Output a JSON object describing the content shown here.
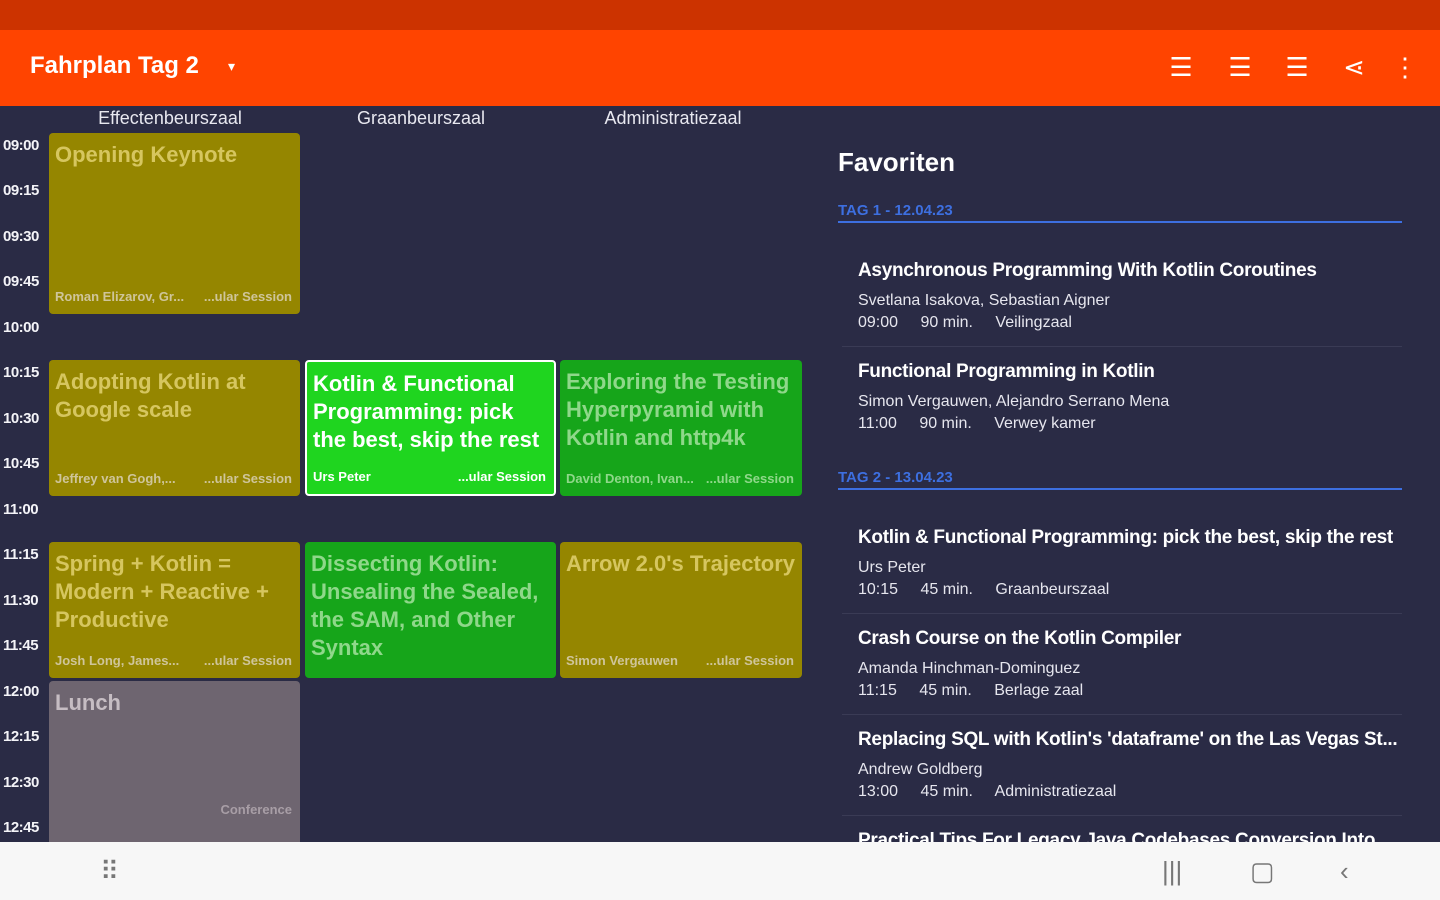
{
  "colors": {
    "appbar": "#ff4400",
    "status": "#cc3300",
    "bg": "#2a2b45",
    "olive": "#958600",
    "green": "#16a51a",
    "highlight": "#1fd51f",
    "gray": "#6e6570",
    "dayHeader": "#3d6fe0"
  },
  "appbar": {
    "title": "Fahrplan",
    "day": "Tag 2",
    "caret": "▾",
    "actions": [
      {
        "name": "add-list-icon",
        "glyph": "☰"
      },
      {
        "name": "upload-list-icon",
        "glyph": "☰"
      },
      {
        "name": "export-list-icon",
        "glyph": "☰"
      },
      {
        "name": "share-icon",
        "glyph": "⋖"
      },
      {
        "name": "overflow-menu-icon",
        "glyph": "⋮"
      }
    ]
  },
  "rooms": [
    "Effectenbeurszaal",
    "Graanbeurszaal",
    "Administratiezaal"
  ],
  "times": [
    "09:00",
    "09:15",
    "09:30",
    "09:45",
    "10:00",
    "10:15",
    "10:30",
    "10:45",
    "11:00",
    "11:15",
    "11:30",
    "11:45",
    "12:00",
    "12:15",
    "12:30",
    "12:45"
  ],
  "sessions": [
    {
      "title": "Opening Keynote",
      "speakers": "Roman Elizarov, Gr...",
      "type": "...ular Session"
    },
    {
      "title": "Adopting Kotlin at Google scale",
      "speakers": "Jeffrey van Gogh,...",
      "type": "...ular Session"
    },
    {
      "title": "Kotlin & Functional Programming: pick the best, skip the rest",
      "speakers": "Urs Peter",
      "type": "...ular Session"
    },
    {
      "title": "Exploring the Testing Hyperpyramid with Kotlin and http4k",
      "speakers": "David Denton, Ivan...",
      "type": "...ular Session"
    },
    {
      "title": "Spring + Kotlin = Modern + Reactive + Productive",
      "speakers": "Josh Long, James...",
      "type": "...ular Session"
    },
    {
      "title": "Dissecting Kotlin: Unsealing the Sealed, the SAM, and Other Syntax",
      "speakers": "",
      "type": ""
    },
    {
      "title": "Arrow 2.0's Trajectory",
      "speakers": "Simon Vergauwen",
      "type": "...ular Session"
    },
    {
      "title": "Lunch",
      "speakers": "",
      "type": "Conference"
    }
  ],
  "favorites": {
    "heading": "Favoriten",
    "days": [
      {
        "label": "TAG 1 - 12.04.23",
        "items": [
          {
            "title": "Asynchronous Programming With Kotlin Coroutines",
            "speakers": "Svetlana Isakova, Sebastian Aigner",
            "time": "09:00",
            "duration": "90 min.",
            "room": "Veilingzaal"
          },
          {
            "title": "Functional Programming in Kotlin",
            "speakers": "Simon Vergauwen, Alejandro Serrano Mena",
            "time": "11:00",
            "duration": "90 min.",
            "room": "Verwey kamer"
          }
        ]
      },
      {
        "label": "TAG 2 - 13.04.23",
        "items": [
          {
            "title": "Kotlin & Functional Programming: pick the best, skip the rest",
            "speakers": "Urs Peter",
            "time": "10:15",
            "duration": "45 min.",
            "room": "Graanbeurszaal"
          },
          {
            "title": "Crash Course on the Kotlin Compiler",
            "speakers": "Amanda Hinchman-Dominguez",
            "time": "11:15",
            "duration": "45 min.",
            "room": "Berlage zaal"
          },
          {
            "title": "Replacing SQL with Kotlin's 'dataframe' on the Las Vegas St...",
            "speakers": "Andrew Goldberg",
            "time": "13:00",
            "duration": "45 min.",
            "room": "Administratiezaal"
          },
          {
            "title": "Practical Tips For Legacy Java Codebases Conversion Into ...",
            "speakers": "",
            "time": "",
            "duration": "",
            "room": ""
          }
        ]
      }
    ]
  },
  "navbar": {
    "apps": "⠿",
    "recents": "|||",
    "home": "▢",
    "back": "‹"
  }
}
